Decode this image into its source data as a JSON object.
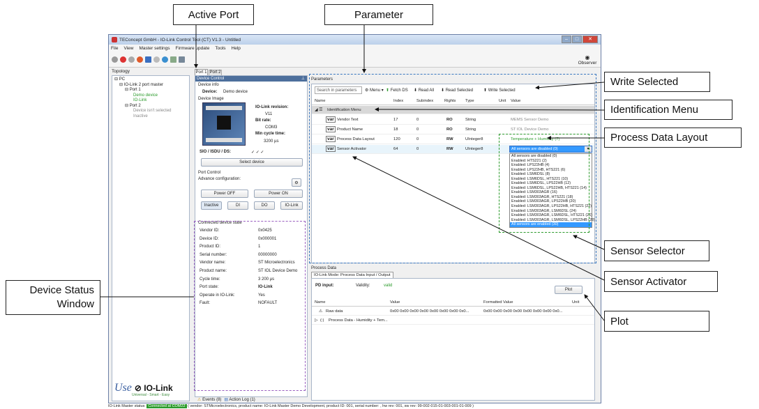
{
  "callouts": {
    "active_port": "Active Port",
    "parameter": "Parameter",
    "write_selected": "Write Selected",
    "identification_menu": "Identification Menu",
    "process_data_layout": "Process Data Layout",
    "sensor_selector": "Sensor Selector",
    "sensor_activator": "Sensor Activator",
    "plot": "Plot",
    "device_status_1": "Device Status",
    "device_status_2": "Window"
  },
  "window": {
    "title": "TEConcept GmbH - IO-Link Control Tool (CT) V1.3 - Untitled",
    "menu": [
      "File",
      "View",
      "Master settings",
      "Firmware update",
      "Tools",
      "Help"
    ],
    "observer": "Observer"
  },
  "topology": {
    "header": "Topology",
    "pc": "PC",
    "master": "IO-Link 2 port master",
    "port1": "Port 1",
    "demo_device": "Demo device",
    "iolink": "IO-Link",
    "port2": "Port 2",
    "not_selected": "Device isn't selected",
    "inactive": "Inactive"
  },
  "logo": {
    "use": "Use",
    "brand": "IO-Link",
    "tagline": "Universal - Smart - Easy"
  },
  "ports": {
    "tab1": "Port 1",
    "tab2": "Port 2"
  },
  "device_control": {
    "header": "Device Control",
    "pin": "—",
    "device_info": "Device info",
    "device_label": "Device:",
    "device_value": "Demo device",
    "device_image": "Device Image",
    "revision_label": "IO-Link revision:",
    "revision_value": "V11",
    "bitrate_label": "Bit rate:",
    "bitrate_value": "COM3",
    "cycle_label": "Min cycle time:",
    "cycle_value": "3200 µs",
    "sio_label": "SIO / ISDU / DS:",
    "checks": "✓     ✓     ✓",
    "select_device": "Select device",
    "port_control": "Port Control",
    "advance": "Advance configuration:",
    "power_off": "Power OFF",
    "power_on": "Power ON",
    "inactive": "Inactive",
    "di": "DI",
    "do": "DO",
    "iolink": "IO-Link"
  },
  "connected_state": {
    "header": "Connected device state",
    "rows": [
      {
        "label": "Vendor ID:",
        "value": "0x0425"
      },
      {
        "label": "Device ID:",
        "value": "0x000001"
      },
      {
        "label": "Product ID:",
        "value": "1"
      },
      {
        "label": "Serial number:",
        "value": "00000000"
      },
      {
        "label": "Vendor name:",
        "value": "ST Microelectronics"
      },
      {
        "label": "Product name:",
        "value": "ST IOL Device Demo"
      },
      {
        "label": "Cycle time:",
        "value": "3 200 µs"
      },
      {
        "label": "Port state:",
        "value": "IO-Link"
      },
      {
        "label": "Operate in IO-Link:",
        "value": "Yes"
      },
      {
        "label": "Fault:",
        "value": "NOFAULT"
      }
    ]
  },
  "bottom_tabs": {
    "events": "Events (8)",
    "action_log": "Action Log (1)"
  },
  "parameters": {
    "header": "Parameters",
    "search_placeholder": "Search in parameters",
    "menu": "Menu",
    "fetch_ds": "Fetch DS",
    "read_all": "Read All",
    "read_selected": "Read Selected",
    "write_selected": "Write Selected",
    "columns": [
      "Name",
      "Index",
      "Subindex",
      "Rights",
      "Type",
      "Unit",
      "Value"
    ],
    "group": "Identification Menu",
    "rows": [
      {
        "tag": "var",
        "name": "Vendor Text",
        "index": "17",
        "sub": "0",
        "rights": "RO",
        "type": "String",
        "value": "MEMS Sensor Demo"
      },
      {
        "tag": "var",
        "name": "Product Name",
        "index": "18",
        "sub": "0",
        "rights": "RO",
        "type": "String",
        "value": "ST IOL Device Demo"
      },
      {
        "tag": "var",
        "name": "Process Data Layout",
        "index": "120",
        "sub": "0",
        "rights": "RW",
        "type": "UInteger8",
        "value": "Temperature + Humidity (7)"
      },
      {
        "tag": "var",
        "name": "Sensor Activator",
        "index": "64",
        "sub": "0",
        "rights": "RW",
        "type": "UInteger8",
        "value": "All sensors are disabled (0)"
      }
    ],
    "dropdown_options": [
      "All sensors are disabled (0)",
      "Enabled: HTS221 (2)",
      "Enabled: LPS22HB (4)",
      "Enabled: LPS22HB, HTS221 (6)",
      "Enabled: LSM6DSL (8)",
      "Enabled: LSM6DSL, HTS221 (10)",
      "Enabled: LSM6DSL, LPS22HB (12)",
      "Enabled: LSM6DSL, LPS22HB, HTS221 (14)",
      "Enabled: LSM303AGR (16)",
      "Enabled: LSM303AGR, HTS221 (18)",
      "Enabled: LSM303AGR, LPS22HB (20)",
      "Enabled: LSM303AGR, LPS22HB, HTS221 (22)",
      "Enabled: LSM303AGR, LSM6DSL (24)",
      "Enabled: LSM303AGR, LSM6DSL, HTS221 (26)",
      "Enabled: LSM303AGR, LSM6DSL, LPS22HB (28)",
      "All sensors are enabled (30)"
    ]
  },
  "process_data": {
    "header": "Process Data",
    "tab": "IO-Link Mode: Process Data Input / Output",
    "pd_input": "PD input:",
    "validity_label": "Validity:",
    "validity_value": "valid",
    "plot": "Plot",
    "columns": [
      "Name",
      "Value",
      "Formatted Value",
      "Unit"
    ],
    "raw_name": "Raw data",
    "raw_value": "0x00 0x00 0x00 0x00 0x00 0x00 0x00 0x0...",
    "raw_formatted": "0x00 0x00 0x00 0x00 0x00 0x00 0x00 0x0...",
    "pd_row": "Process Data - Humidity + Tem..."
  },
  "status": {
    "label": "IO-Link Master status:",
    "badge": "Connected at COM22",
    "detail": "( vendor: STMicroelectronics, product name: IO-Link Master Demo Development, product ID: 001, serial number: , hw rev: 001, sw rev: 99-002-015-01-003-001-01-009 )"
  },
  "colors": {
    "purple": "#9a5fc0",
    "blue": "#3a78c0",
    "green": "#2a9a2a"
  }
}
